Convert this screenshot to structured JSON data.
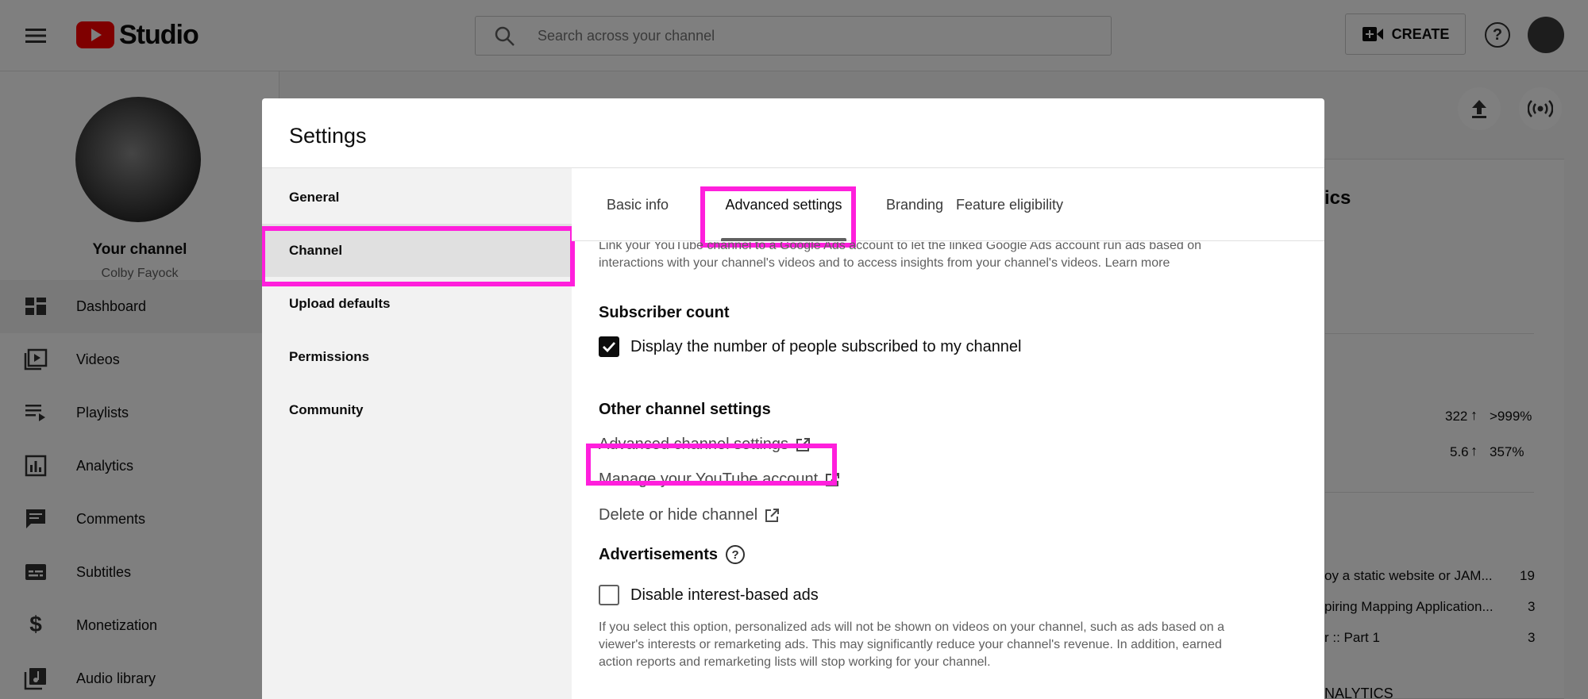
{
  "header": {
    "logo_text": "Studio",
    "search_placeholder": "Search across your channel",
    "create_label": "CREATE"
  },
  "sidebar": {
    "channel_title": "Your channel",
    "channel_name": "Colby Fayock",
    "items": [
      {
        "label": "Dashboard",
        "icon": "dashboard-icon"
      },
      {
        "label": "Videos",
        "icon": "videos-icon"
      },
      {
        "label": "Playlists",
        "icon": "playlists-icon"
      },
      {
        "label": "Analytics",
        "icon": "analytics-icon"
      },
      {
        "label": "Comments",
        "icon": "comments-icon"
      },
      {
        "label": "Subtitles",
        "icon": "subtitles-icon"
      },
      {
        "label": "Monetization",
        "icon": "monetization-icon"
      },
      {
        "label": "Audio library",
        "icon": "audio-library-icon"
      }
    ]
  },
  "background": {
    "card_title_partial": "ics",
    "stats": [
      {
        "value": "322",
        "change": ">999%"
      },
      {
        "value": "5.6",
        "change": "357%"
      }
    ],
    "videos": [
      {
        "title": "oy a static website or JAM...",
        "count": "19"
      },
      {
        "title": "piring Mapping Application...",
        "count": "3"
      },
      {
        "title": "r :: Part 1",
        "count": "3"
      }
    ],
    "footer_partial": "NALYTICS"
  },
  "dialog": {
    "title": "Settings",
    "nav": [
      {
        "label": "General"
      },
      {
        "label": "Channel"
      },
      {
        "label": "Upload defaults"
      },
      {
        "label": "Permissions"
      },
      {
        "label": "Community"
      }
    ],
    "tabs": [
      {
        "label": "Basic info"
      },
      {
        "label": "Advanced settings"
      },
      {
        "label": "Branding"
      },
      {
        "label": "Feature eligibility"
      }
    ],
    "ads_link_text": "Link your YouTube channel to a Google Ads account to let the linked Google Ads account run ads based on",
    "ads_link_text2": "interactions with your channel's videos and to access insights from your channel's videos.",
    "learn_more": "Learn more",
    "subscriber_heading": "Subscriber count",
    "subscriber_checkbox": "Display the number of people subscribed to my channel",
    "other_heading": "Other channel settings",
    "links": [
      {
        "label": "Advanced channel settings"
      },
      {
        "label": "Manage your YouTube account"
      },
      {
        "label": "Delete or hide channel"
      }
    ],
    "ads_heading": "Advertisements",
    "ads_checkbox": "Disable interest-based ads",
    "ads_desc1": "If you select this option, personalized ads will not be shown on videos on your channel, such as ads based on a",
    "ads_desc2": "viewer's interests or remarketing ads. This may significantly reduce your channel's revenue. In addition, earned",
    "ads_desc3": "action reports and remarketing lists will stop working for your channel."
  },
  "colors": {
    "highlight": "#ff1fdc",
    "youtube_red": "#ff0000"
  }
}
